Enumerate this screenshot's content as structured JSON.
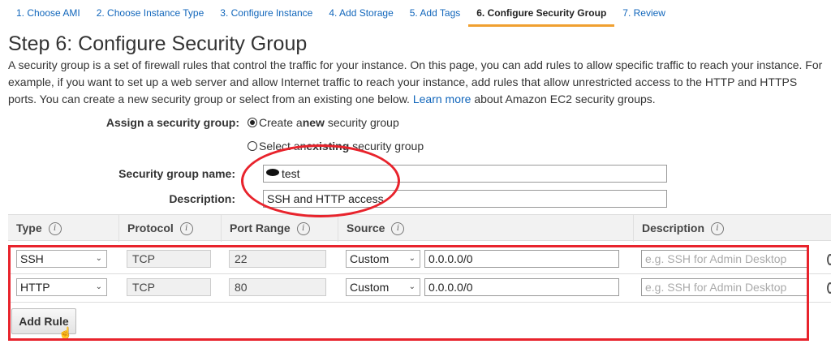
{
  "tabs": [
    {
      "label": "1. Choose AMI"
    },
    {
      "label": "2. Choose Instance Type"
    },
    {
      "label": "3. Configure Instance"
    },
    {
      "label": "4. Add Storage"
    },
    {
      "label": "5. Add Tags"
    },
    {
      "label": "6. Configure Security Group",
      "active": true
    },
    {
      "label": "7. Review"
    }
  ],
  "page": {
    "title": "Step 6: Configure Security Group",
    "description_before_link": "A security group is a set of firewall rules that control the traffic for your instance. On this page, you can add rules to allow specific traffic to reach your instance. For example, if you want to set up a web server and allow Internet traffic to reach your instance, add rules that allow unrestricted access to the HTTP and HTTPS ports. You can create a new security group or select from an existing one below.",
    "link_text": "Learn more",
    "description_after_link": "about Amazon EC2 security groups."
  },
  "form": {
    "assign_label": "Assign a security group:",
    "option_new_pre": "Create a ",
    "option_new_bold": "new",
    "option_new_post": " security group",
    "option_existing_pre": "Select an ",
    "option_existing_bold": "existing",
    "option_existing_post": " security group",
    "name_label": "Security group name:",
    "name_value": "test",
    "description_label": "Description:",
    "description_value": "SSH and HTTP access"
  },
  "table": {
    "headers": {
      "type": "Type",
      "protocol": "Protocol",
      "port_range": "Port Range",
      "source": "Source",
      "description": "Description"
    },
    "info_glyph": "i",
    "rows": [
      {
        "type": "SSH",
        "protocol": "TCP",
        "port_range": "22",
        "source": "Custom",
        "cidr": "0.0.0.0/0",
        "description_placeholder": "e.g. SSH for Admin Desktop"
      },
      {
        "type": "HTTP",
        "protocol": "TCP",
        "port_range": "80",
        "source": "Custom",
        "cidr": "0.0.0.0/0",
        "description_placeholder": "e.g. SSH for Admin Desktop"
      }
    ],
    "add_rule_label": "Add Rule"
  },
  "icons": {
    "chevron": "chevron-down-icon",
    "info": "info-icon",
    "cursor": "hand-cursor-icon"
  },
  "colors": {
    "link": "#1166bb",
    "active_tab_underline": "#f0a030",
    "annotation_red": "#e8232c"
  }
}
